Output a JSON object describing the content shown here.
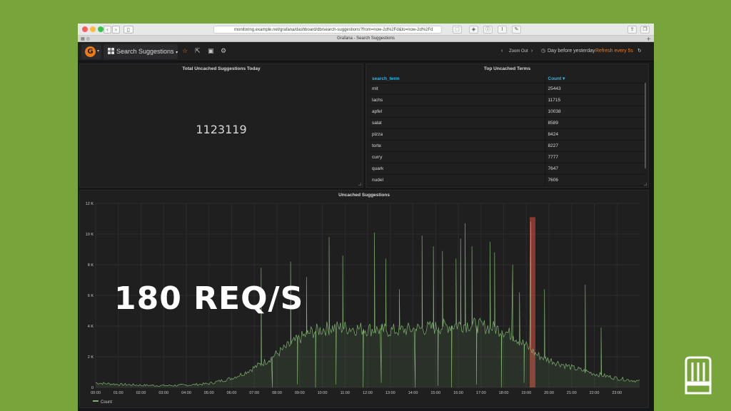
{
  "browser": {
    "url": "monitoring.example.net/grafana/dashboard/db/search-suggestions?from=now-2d%2Fd&to=now-2d%2Fd",
    "tab_title": "Grafana - Search Suggestions"
  },
  "navbar": {
    "logo_letter": "G",
    "dashboard_title": "Search Suggestions",
    "zoom_out": "Zoom Out",
    "time_range": "Day before yesterday",
    "refresh": "Refresh every 5s"
  },
  "stat_panel": {
    "title": "Total Uncached Suggestions Today",
    "value": "1123119"
  },
  "terms_panel": {
    "title": "Top Uncached Terms",
    "columns": [
      "search_term",
      "Count ▾"
    ],
    "rows": [
      [
        "mit",
        "25443"
      ],
      [
        "lachs",
        "11715"
      ],
      [
        "apfel",
        "10038"
      ],
      [
        "salat",
        "8589"
      ],
      [
        "pizza",
        "8424"
      ],
      [
        "torte",
        "8227"
      ],
      [
        "curry",
        "7777"
      ],
      [
        "quark",
        "7647"
      ],
      [
        "nudel",
        "7606"
      ]
    ]
  },
  "graph_panel": {
    "title": "Uncached Suggestions",
    "legend": "Count"
  },
  "overlay_text": "180 req/s",
  "colors": {
    "series": "#7eb26d",
    "highlight": "#e24d42",
    "accent": "#eb7b18",
    "link": "#33b5e5"
  },
  "chart_data": {
    "type": "line",
    "title": "Uncached Suggestions",
    "ylim": [
      0,
      12000
    ],
    "y_ticks": [
      {
        "value": 0,
        "label": "0"
      },
      {
        "value": 2000,
        "label": "2 K"
      },
      {
        "value": 4000,
        "label": "4 K"
      },
      {
        "value": 6000,
        "label": "6 K"
      },
      {
        "value": 8000,
        "label": "8 K"
      },
      {
        "value": 10000,
        "label": "10 K"
      },
      {
        "value": 12000,
        "label": "12 K"
      }
    ],
    "x_ticks": [
      "00:00",
      "01:00",
      "02:00",
      "03:00",
      "04:00",
      "05:00",
      "06:00",
      "07:00",
      "08:00",
      "09:00",
      "10:00",
      "11:00",
      "12:00",
      "13:00",
      "14:00",
      "15:00",
      "16:00",
      "17:00",
      "18:00",
      "19:00",
      "20:00",
      "21:00",
      "22:00",
      "23:00"
    ],
    "grid": true,
    "series": [
      {
        "name": "Count",
        "hour": [
          0,
          1,
          2,
          3,
          4,
          5,
          6,
          6.5,
          7,
          7.5,
          8,
          8.5,
          9,
          9.5,
          10,
          10.5,
          11,
          12,
          13,
          14,
          15,
          15.5,
          16,
          16.5,
          17,
          17.5,
          18,
          18.5,
          19,
          19.5,
          20,
          21,
          22,
          23,
          24
        ],
        "values": [
          300,
          200,
          150,
          120,
          150,
          250,
          600,
          900,
          1300,
          1700,
          2200,
          2700,
          3200,
          3600,
          3800,
          3900,
          3900,
          3800,
          3700,
          3800,
          3900,
          4000,
          4100,
          4100,
          4000,
          3900,
          3700,
          3300,
          2700,
          2100,
          1800,
          1300,
          900,
          600,
          400
        ]
      }
    ],
    "spikes": [
      {
        "hour": 7.3,
        "value": 7800
      },
      {
        "hour": 8.6,
        "value": 8200
      },
      {
        "hour": 9.3,
        "value": 7200
      },
      {
        "hour": 10.3,
        "value": 9800
      },
      {
        "hour": 10.9,
        "value": 8600
      },
      {
        "hour": 12.3,
        "value": 10100
      },
      {
        "hour": 12.8,
        "value": 8400
      },
      {
        "hour": 13.4,
        "value": 6400
      },
      {
        "hour": 14.4,
        "value": 9900
      },
      {
        "hour": 14.9,
        "value": 9200
      },
      {
        "hour": 15.3,
        "value": 8900
      },
      {
        "hour": 15.9,
        "value": 8400
      },
      {
        "hour": 16.1,
        "value": 9700
      },
      {
        "hour": 16.3,
        "value": 10700
      },
      {
        "hour": 16.6,
        "value": 9200
      },
      {
        "hour": 17.4,
        "value": 9500
      },
      {
        "hour": 17.6,
        "value": 8800
      },
      {
        "hour": 18.4,
        "value": 8000
      },
      {
        "hour": 18.7,
        "value": 6200
      },
      {
        "hour": 19.2,
        "value": 10800
      },
      {
        "hour": 19.8,
        "value": 6400
      },
      {
        "hour": 21.6,
        "value": 6700
      },
      {
        "hour": 22.3,
        "value": 3900
      }
    ],
    "dips": [
      {
        "hour": 7.8,
        "value": 0
      },
      {
        "hour": 8.9,
        "value": 200
      },
      {
        "hour": 9.7,
        "value": 0
      },
      {
        "hour": 10.6,
        "value": 200
      },
      {
        "hour": 11.8,
        "value": 0
      },
      {
        "hour": 12.6,
        "value": 300
      },
      {
        "hour": 14.1,
        "value": 0
      },
      {
        "hour": 15.1,
        "value": 100
      },
      {
        "hour": 15.7,
        "value": 0
      },
      {
        "hour": 16.8,
        "value": 200
      },
      {
        "hour": 17.9,
        "value": 0
      },
      {
        "hour": 18.9,
        "value": 300
      }
    ],
    "highlight_region": {
      "from_hour": 19.15,
      "to_hour": 19.4,
      "top": 11100
    }
  }
}
